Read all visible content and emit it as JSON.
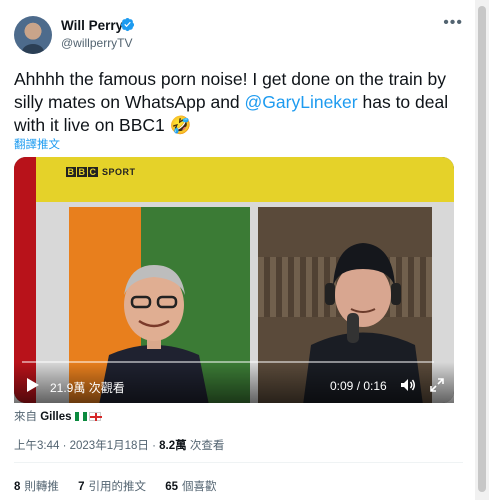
{
  "author": {
    "name": "Will Perry",
    "handle": "@willperryTV",
    "verified": true
  },
  "tweet": {
    "text_before": "Ahhhh the famous porn noise! I get done on the train by silly mates on WhatsApp and ",
    "mention": "@GaryLineker",
    "text_after": " has to deal with it live on BBC1 ",
    "emoji": "🤣",
    "translate_label": "翻譯推文"
  },
  "video": {
    "channel_label": "SPORT",
    "bbc_letters": [
      "B",
      "B",
      "C"
    ],
    "views": "21.9萬 次觀看",
    "time": "0:09 / 0:16",
    "progress": 0.5625
  },
  "source": {
    "prefix": "來自",
    "app": "Gilles"
  },
  "meta": {
    "time": "上午3:44",
    "date": "2023年1月18日",
    "views_count": "8.2萬",
    "views_label": "次查看"
  },
  "stats": [
    {
      "count": "8",
      "label": "則轉推"
    },
    {
      "count": "7",
      "label": "引用的推文"
    },
    {
      "count": "65",
      "label": "個喜歡"
    }
  ],
  "colors": {
    "accent": "#1d9bf0",
    "text": "#0f1419",
    "muted": "#536471",
    "bbc_yellow": "#e5d229",
    "bbc_red": "#b8121a"
  }
}
